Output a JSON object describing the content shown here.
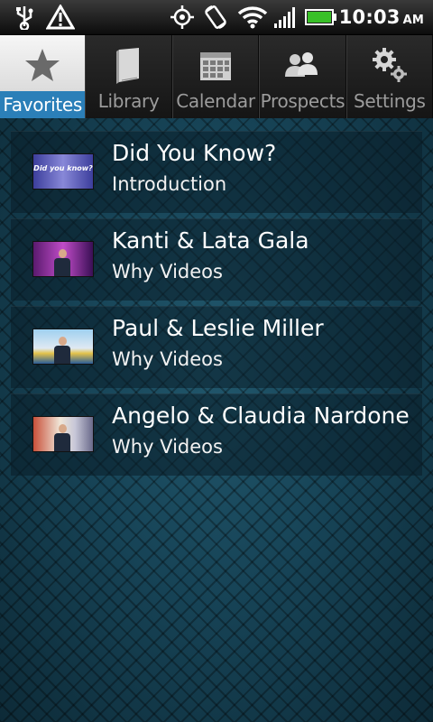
{
  "status_bar": {
    "time": "10:03",
    "ampm": "AM",
    "icons": [
      "usb-icon",
      "alert-icon",
      "gps-icon",
      "rotate-icon",
      "wifi-icon",
      "signal-icon",
      "battery-icon"
    ]
  },
  "tabs": [
    {
      "label": "Favorites",
      "icon": "star-icon",
      "active": true
    },
    {
      "label": "Library",
      "icon": "book-icon",
      "active": false
    },
    {
      "label": "Calendar",
      "icon": "calendar-icon",
      "active": false
    },
    {
      "label": "Prospects",
      "icon": "people-icon",
      "active": false
    },
    {
      "label": "Settings",
      "icon": "gears-icon",
      "active": false
    }
  ],
  "favorites": [
    {
      "title": "Did You Know?",
      "subtitle": "Introduction",
      "thumb_text": "Did you know?"
    },
    {
      "title": "Kanti & Lata Gala",
      "subtitle": "Why Videos"
    },
    {
      "title": "Paul & Leslie Miller",
      "subtitle": "Why Videos"
    },
    {
      "title": "Angelo & Claudia Nardone",
      "subtitle": "Why Videos"
    }
  ],
  "colors": {
    "tab_active_label_bg": "#2b7fb8",
    "background": "#174457",
    "battery": "#39c028"
  }
}
